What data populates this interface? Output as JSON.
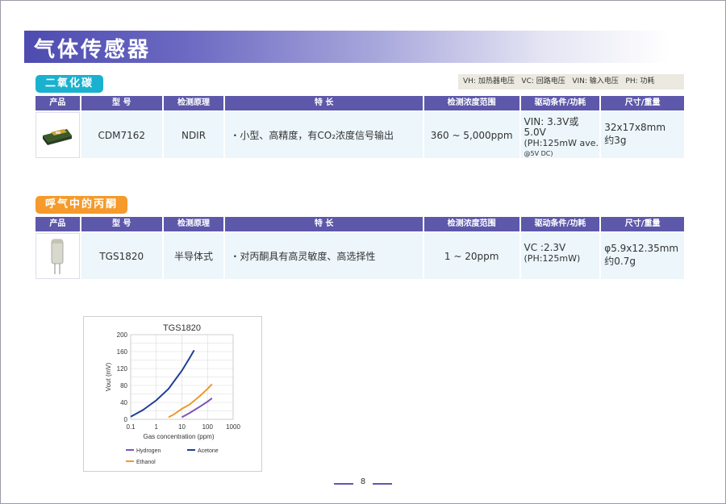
{
  "page_title": "气体传感器",
  "legend": {
    "vh": "VH: 加热器电压",
    "vc": "VC: 回路电压",
    "vin": "VIN: 输入电压",
    "ph": "PH: 功耗"
  },
  "table_headers": [
    "产品",
    "型 号",
    "检测原理",
    "特    长",
    "检测浓度范围",
    "驱动条件/功耗",
    "尺寸/重量"
  ],
  "sections": [
    {
      "label": "二氧化碳",
      "color": "#1ab1cf",
      "model": "CDM7162",
      "principle": "NDIR",
      "feature": "・小型、高精度，有CO₂浓度信号输出",
      "range": "360 ~ 5,000ppm",
      "drive_line1": "VIN: 3.3V或5.0V",
      "drive_line2": "(PH:125mW ave.",
      "drive_line3": "@5V DC)",
      "size_line1": "32x17x8mm",
      "size_line2": "约3g"
    },
    {
      "label": "呼气中的丙酮",
      "color": "#f59a2b",
      "model": "TGS1820",
      "principle": "半导体式",
      "feature": "・对丙酮具有高灵敏度、高选择性",
      "range": "1 ~ 20ppm",
      "drive_line1": "VC :2.3V",
      "drive_line2": "(PH:125mW)",
      "drive_line3": "",
      "size_line1": "φ5.9x12.35mm",
      "size_line2": "约0.7g"
    }
  ],
  "chart_data": {
    "type": "line",
    "title": "TGS1820",
    "xlabel": "Gas concentration (ppm)",
    "ylabel": "Vout (mV)",
    "x_scale": "log",
    "xlim": [
      0.1,
      1000
    ],
    "ylim": [
      0,
      200
    ],
    "x_ticks": [
      "0.1",
      "1",
      "10",
      "100",
      "1000"
    ],
    "y_ticks": [
      "0",
      "20",
      "40",
      "60",
      "80",
      "100",
      "120",
      "140",
      "160",
      "180",
      "200"
    ],
    "grid": true,
    "legend_position": "bottom",
    "series": [
      {
        "name": "Hydrogen",
        "color": "#7d55b5",
        "x": [
          10,
          20,
          50,
          100,
          150
        ],
        "y": [
          5,
          15,
          30,
          42,
          50
        ]
      },
      {
        "name": "Acetone",
        "color": "#1f3f94",
        "x": [
          0.1,
          0.3,
          1,
          3,
          10,
          20,
          30
        ],
        "y": [
          6,
          22,
          45,
          72,
          115,
          145,
          163
        ]
      },
      {
        "name": "Ethanol",
        "color": "#f0982a",
        "x": [
          3,
          5,
          10,
          20,
          50,
          100,
          150
        ],
        "y": [
          5,
          12,
          25,
          35,
          55,
          72,
          83
        ]
      }
    ]
  },
  "page_number": "8"
}
